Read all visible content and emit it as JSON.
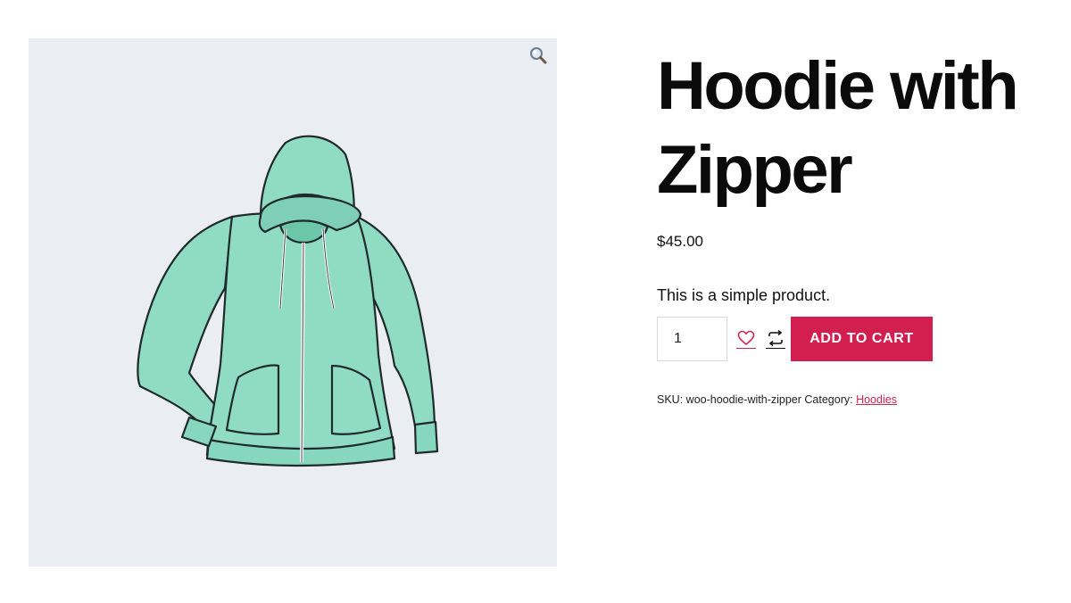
{
  "product": {
    "title": "Hoodie with Zipper",
    "price": "$45.00",
    "short_description": "This is a simple product.",
    "quantity": "1",
    "add_to_cart_label": "ADD TO CART",
    "sku_label": "SKU:",
    "sku_value": "woo-hoodie-with-zipper",
    "category_label": "Category:",
    "category_value": "Hoodies"
  },
  "icons": {
    "zoom": "magnifier-icon",
    "wishlist": "heart-icon",
    "compare": "compare-arrows-icon"
  },
  "colors": {
    "accent": "#d31f50",
    "link": "#d0264f",
    "gallery_bg": "#eaedf1",
    "hoodie": "#8fdcc3"
  }
}
